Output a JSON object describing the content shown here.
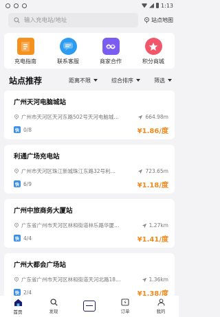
{
  "status_bar": {
    "time": "1:13"
  },
  "search": {
    "placeholder": "输入充电站/地址",
    "map_button": "站点地图"
  },
  "menu": [
    {
      "label": "充电指南",
      "icon": "document-icon",
      "color": "#f5921f"
    },
    {
      "label": "联系客服",
      "icon": "chat-icon",
      "color": "#2c9cf2"
    },
    {
      "label": "商家合作",
      "icon": "handshake-icon",
      "color": "#7b5cf0"
    },
    {
      "label": "积分商城",
      "icon": "star-icon",
      "color": "#f2566a"
    }
  ],
  "list_header": {
    "title": "站点推荐",
    "filters": [
      "距离不限",
      "综合排序",
      "筛选"
    ]
  },
  "stations": [
    {
      "name": "广州天河电脑城站",
      "address": "广州市天河区天河东路502号天河电脑城…",
      "distance": "664.98m",
      "slots": "0/8",
      "price": "¥1.86/度"
    },
    {
      "name": "利通广场充电站",
      "address": "广州市天河区珠江新城珠江东路32号利…",
      "distance": "723.65m",
      "slots": "6/9",
      "price": "¥1.18/度"
    },
    {
      "name": "广州中旅商务大厦站",
      "address": "广东省广州市天河区林和街道林乐路华厦…",
      "distance": "1.27km",
      "slots": "4/4",
      "price": "¥1.41/度"
    },
    {
      "name": "广州大都会广场站",
      "address": "广东省广州市天河区林和街道天河北路18…",
      "distance": "1.36km",
      "slots": "2/4",
      "price": "¥1.38/度"
    }
  ],
  "badge_label": "快",
  "tabs": [
    {
      "label": "首页",
      "icon": "home-icon"
    },
    {
      "label": "发现",
      "icon": "search-icon"
    },
    {
      "label": "",
      "icon": "scan-icon"
    },
    {
      "label": "订单",
      "icon": "order-icon"
    },
    {
      "label": "我的",
      "icon": "profile-icon"
    }
  ]
}
